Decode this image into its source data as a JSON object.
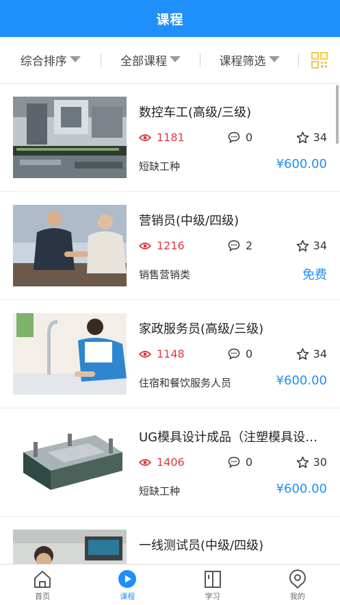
{
  "header": {
    "title": "课程"
  },
  "filters": {
    "sort_label": "综合排序",
    "all_courses_label": "全部课程",
    "screen_label": "课程筛选",
    "qr_icon": "qr-code-icon"
  },
  "courses": [
    {
      "title": "数控车工(高级/三级)",
      "views": "1181",
      "comments": "0",
      "stars": "34",
      "category": "短缺工种",
      "price": "¥600.00",
      "image": "cnc-machine"
    },
    {
      "title": "营销员(中级/四级)",
      "views": "1216",
      "comments": "2",
      "stars": "34",
      "category": "销售营销类",
      "price": "免费",
      "image": "handshake"
    },
    {
      "title": "家政服务员(高级/三级)",
      "views": "1148",
      "comments": "0",
      "stars": "34",
      "category": "住宿和餐饮服务人员",
      "price": "¥600.00",
      "image": "cleaning"
    },
    {
      "title": "UG模具设计成品（注塑模具设计）",
      "views": "1406",
      "comments": "0",
      "stars": "30",
      "category": "短缺工种",
      "price": "¥600.00",
      "image": "mold"
    },
    {
      "title": "一线测试员(中级/四级)",
      "views": "",
      "comments": "",
      "stars": "",
      "category": "",
      "price": "",
      "image": "tester"
    }
  ],
  "tabs": [
    {
      "label": "首页",
      "icon": "home-icon"
    },
    {
      "label": "课程",
      "icon": "play-icon",
      "active": true
    },
    {
      "label": "学习",
      "icon": "book-icon"
    },
    {
      "label": "我的",
      "icon": "profile-icon"
    }
  ],
  "colors": {
    "accent": "#1e8ffb",
    "views": "#e0393e",
    "qr": "#f2c94c"
  }
}
